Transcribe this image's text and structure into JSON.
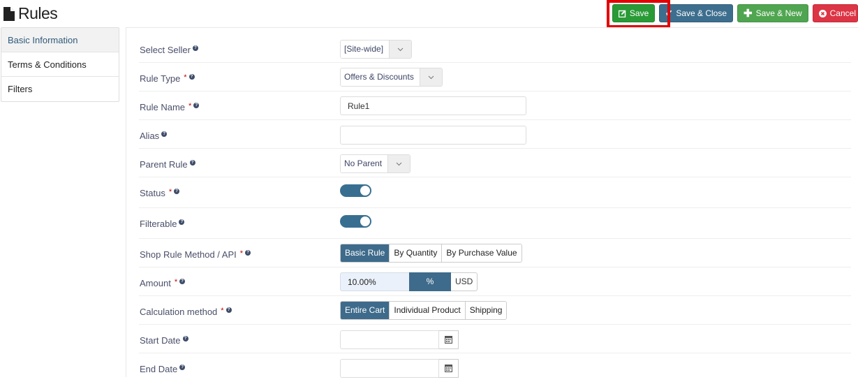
{
  "page": {
    "title": "Rules",
    "icon": "file-icon"
  },
  "toolbar": {
    "save": {
      "label": "Save",
      "icon": "edit-icon",
      "color": "#2a9a37"
    },
    "save_close": {
      "label": "Save & Close",
      "icon": "check-icon",
      "color": "#3d6e8e"
    },
    "save_new": {
      "label": "Save & New",
      "icon": "plus-icon",
      "color": "#50a550"
    },
    "cancel": {
      "label": "Cancel",
      "icon": "close-circle-icon",
      "color": "#dc3545"
    },
    "highlight_color": "#e30000"
  },
  "sidebar": {
    "items": [
      {
        "label": "Basic Information",
        "active": true
      },
      {
        "label": "Terms & Conditions",
        "active": false
      },
      {
        "label": "Filters",
        "active": false
      }
    ]
  },
  "form": {
    "seller": {
      "label": "Select Seller",
      "value": "[Site-wide]"
    },
    "rule_type": {
      "label": "Rule Type",
      "value": "Offers & Discounts"
    },
    "rule_name": {
      "label": "Rule Name",
      "value": "Rule1"
    },
    "alias": {
      "label": "Alias",
      "value": ""
    },
    "parent_rule": {
      "label": "Parent Rule",
      "value": "No Parent"
    },
    "status": {
      "label": "Status",
      "on": true
    },
    "filterable": {
      "label": "Filterable",
      "on": true
    },
    "method": {
      "label": "Shop Rule Method / API",
      "options": [
        "Basic Rule",
        "By Quantity",
        "By Purchase Value"
      ],
      "selected": "Basic Rule"
    },
    "amount": {
      "label": "Amount",
      "value": "10.00%",
      "unit_percent": "%",
      "unit_usd": "USD",
      "selected_unit": "%"
    },
    "calc": {
      "label": "Calculation method",
      "options": [
        "Entire Cart",
        "Individual Product",
        "Shipping"
      ],
      "selected": "Entire Cart"
    },
    "start_date": {
      "label": "Start Date",
      "value": ""
    },
    "end_date": {
      "label": "End Date",
      "value": ""
    },
    "required_mark": "*",
    "help_mark": "?"
  },
  "colors": {
    "accent": "#3e6b8b",
    "toggle_on": "#386f91"
  }
}
